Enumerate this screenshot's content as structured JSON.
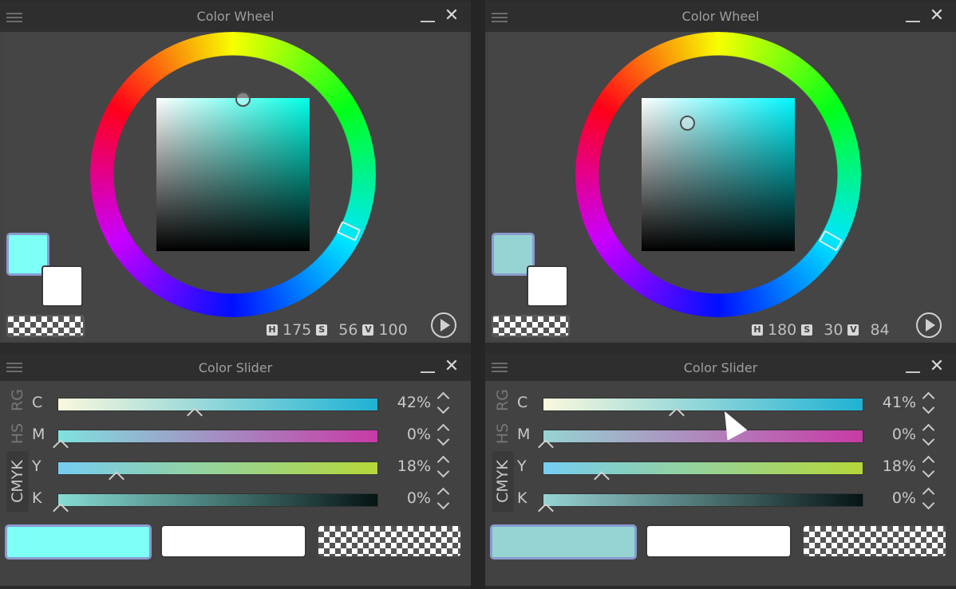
{
  "left": {
    "wheel_title": "Color Wheel",
    "slider_title": "Color Slider",
    "main_color": "#7dfff5",
    "sv_hue_color": "#00ffe6",
    "hsv": {
      "h_label": "H",
      "h": "175",
      "s_label": "S",
      "s": "56",
      "v_label": "V",
      "v": "100"
    },
    "sliders": [
      {
        "label": "C",
        "value": "42%",
        "level": 42
      },
      {
        "label": "M",
        "value": "0%",
        "level": 0
      },
      {
        "label": "Y",
        "value": "18%",
        "level": 18
      },
      {
        "label": "K",
        "value": "0%",
        "level": 0
      }
    ],
    "tabs": [
      "RG",
      "HS",
      "CMYK"
    ]
  },
  "right": {
    "wheel_title": "Color Wheel",
    "slider_title": "Color Slider",
    "main_color": "#96d4d3",
    "sv_hue_color": "#00f8ff",
    "hsv": {
      "h_label": "H",
      "h": "180",
      "s_label": "S",
      "s": "30",
      "v_label": "V",
      "v": "84"
    },
    "sliders": [
      {
        "label": "C",
        "value": "41%",
        "level": 41
      },
      {
        "label": "M",
        "value": "0%",
        "level": 0
      },
      {
        "label": "Y",
        "value": "18%",
        "level": 18
      },
      {
        "label": "K",
        "value": "0%",
        "level": 0
      }
    ],
    "tabs": [
      "RG",
      "HS",
      "CMYK"
    ]
  },
  "colors": {
    "selection_border": "#8a9bd0",
    "panel_bg": "#424242"
  },
  "icons": [
    "menu-icon",
    "minimize-icon",
    "close-icon",
    "play-icon",
    "hsv-badge-icon",
    "updown-icon",
    "caret-icon",
    "cursor-icon"
  ]
}
